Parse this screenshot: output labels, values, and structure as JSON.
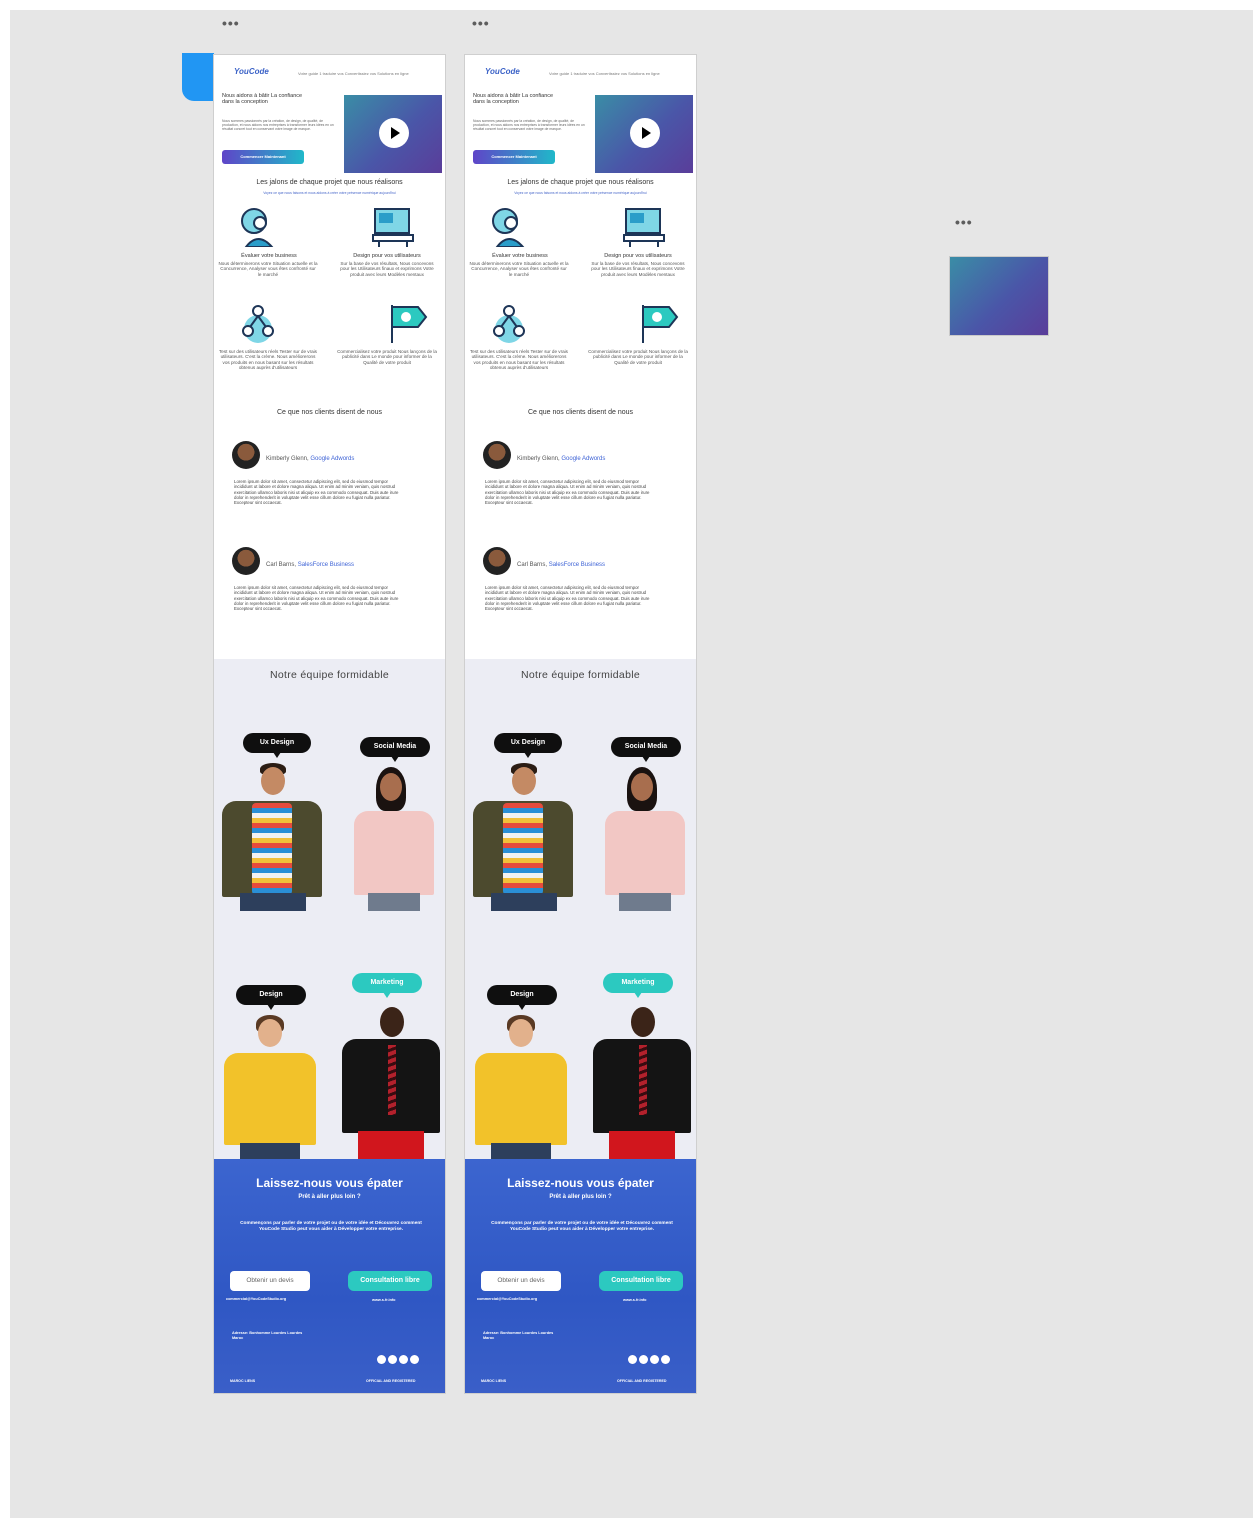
{
  "canvas": {
    "menu_icon_glyph": "•••"
  },
  "email": {
    "logo": "YouCode",
    "tagline": "Votre guide 1 traduire vos Convertissiez vos Solutions en ligne",
    "hero": {
      "title": "Nous aidons à bâtir La confiance dans la conception",
      "text": "Nous sommes passionnés par la création, de design, de qualité, de production, et nous aidons nos entreprises à transformer leurs idées en un résultat concret tout en conservant votre image de marque.",
      "button": "Commencer Maintenant"
    },
    "steps_title": "Les jalons de chaque projet que nous réalisons",
    "steps_subtitle": "Voyez ce que nous faisons et nous aidons à créer votre présence numérique aujourd'hui",
    "features": [
      {
        "title": "Évaluer votre business",
        "text": "Nous déterminerons votre Situation actuelle et la Concurrence, Analyser vous êtes confronté sur le marché",
        "icon": "person-analysis-icon"
      },
      {
        "title": "Design pour vos utilisateurs",
        "text": "Sur la base de vos résultats, Nous concevons pour les Utilisateurs finaux et exprimons Votre produit avec leurs Modèles mentaux",
        "icon": "design-monitor-icon"
      },
      {
        "title": "",
        "text": "Test sur des utilisateurs réels Tester sur de vrais utilisateurs. C'est la crème. Nous améliorerons vos produits en nous basant sur les résultats obtenus auprès d'utilisateurs",
        "icon": "user-network-icon"
      },
      {
        "title": "",
        "text": "Commercialisez votre produit Nous lançons de la publicité dans Le monde pour informer de la Qualité de votre produit",
        "icon": "flag-check-icon"
      }
    ],
    "testimonials_title": "Ce que nos clients disent de nous",
    "testimonials": [
      {
        "name": "Kimberly Glenn,",
        "company": "Google Adwords",
        "text": "Lorem ipsum dolor sit amet, consectetur adipiscing elit, sed do eiusmod tempor incididunt ut labore et dolore magna aliqua. Ut enim ad minim veniam, quis nostrud exercitation ullamco laboris nisi ut aliquip ex ea commodo consequat. Duis aute irure dolor in reprehenderit in voluptate velit esse cillum dolore eu fugiat nulla pariatur. Excepteur sint occaecat."
      },
      {
        "name": "Carl Barns,",
        "company": "SalesForce Business",
        "text": "Lorem ipsum dolor sit amet, consectetur adipiscing elit, sed do eiusmod tempor incididunt ut labore et dolore magna aliqua. Ut enim ad minim veniam, quis nostrud exercitation ullamco laboris nisi ut aliquip ex ea commodo consequat. Duis aute irure dolor in reprehenderit in voluptate velit esse cillum dolore eu fugiat nulla pariatur. Excepteur sint occaecat."
      }
    ],
    "team_title": "Notre équipe formidable",
    "team": [
      {
        "role": "Ux Design"
      },
      {
        "role": "Social Media"
      },
      {
        "role": "Design"
      },
      {
        "role": "Marketing"
      }
    ],
    "footer": {
      "title": "Laissez-nous vous épater",
      "subtitle": "Prêt à aller plus loin ?",
      "text": "Commençons par parler de votre projet ou de votre idée et Découvrez comment YouCode Studio peut vous aider à Développer votre entreprise.",
      "quote_button": "Obtenir un devis",
      "consult_button": "Consultation libre",
      "email": "commercial@YouCodeStudio.org",
      "link": "www.s.fr.info",
      "address": "Adresse: Bonhomme Lourdes Lourdes Maroc",
      "bottom_left": "MAROC  LIENS",
      "bottom_right": "OFFICIAL AND REGISTERED"
    }
  },
  "colors": {
    "accent": "#2196f3",
    "footer_blue": "#3358c6",
    "teal": "#2cc9c0",
    "link_blue": "#3e63d6"
  }
}
